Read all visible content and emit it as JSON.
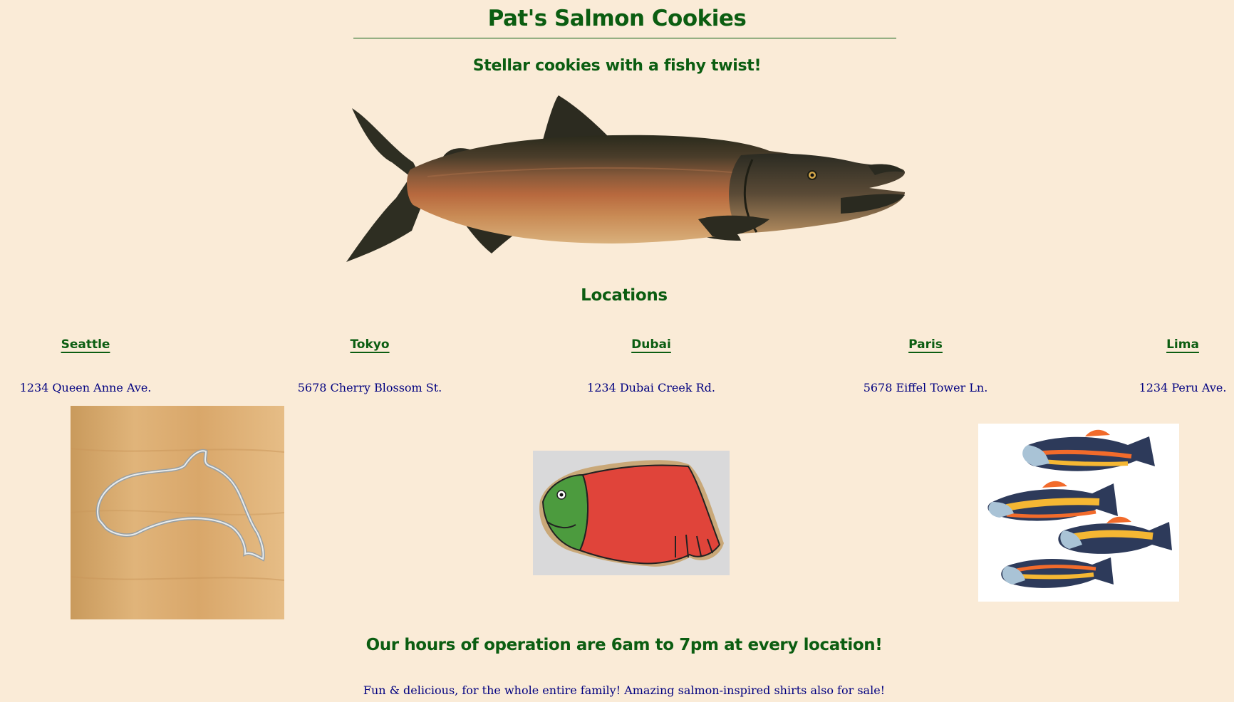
{
  "header": {
    "title": "Pat's Salmon Cookies",
    "tagline": "Stellar cookies with a fishy twist!"
  },
  "hero_image": {
    "icon": "salmon-illustration"
  },
  "locations": {
    "heading": "Locations",
    "stores": [
      {
        "city": "Seattle",
        "address": "1234 Queen Anne Ave."
      },
      {
        "city": "Tokyo",
        "address": "5678 Cherry Blossom St."
      },
      {
        "city": "Dubai",
        "address": "1234 Dubai Creek Rd."
      },
      {
        "city": "Paris",
        "address": "5678 Eiffel Tower Ln."
      },
      {
        "city": "Lima",
        "address": "1234 Peru Ave."
      }
    ]
  },
  "gallery": [
    {
      "icon": "salmon-cookie-cutter-photo"
    },
    {
      "icon": "iced-salmon-cookie-photo"
    },
    {
      "icon": "painted-fish-cookies-photo"
    }
  ],
  "hours": "Our hours of operation are 6am to 7pm at every location!",
  "footer": "Fun & delicious, for the whole entire family! Amazing salmon-inspired shirts also for sale!",
  "colors": {
    "background": "#faebd7",
    "heading": "#0b5d11",
    "body_text": "#000080"
  }
}
